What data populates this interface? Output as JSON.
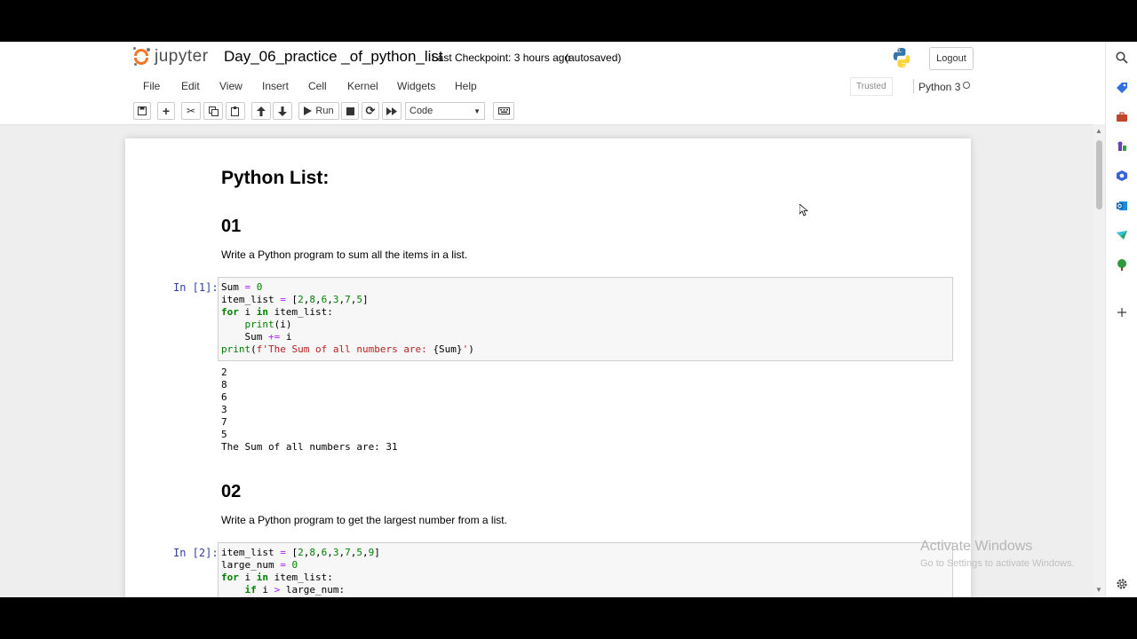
{
  "header": {
    "logo_text": "jupyter",
    "notebook_title": "Day_06_practice _of_python_list",
    "checkpoint": "Last Checkpoint: 3 hours ago",
    "autosave": "(autosaved)",
    "logout": "Logout"
  },
  "menubar": {
    "items": [
      "File",
      "Edit",
      "View",
      "Insert",
      "Cell",
      "Kernel",
      "Widgets",
      "Help"
    ],
    "trusted": "Trusted",
    "kernel_name": "Python 3"
  },
  "toolbar": {
    "run_label": "Run",
    "cell_type": "Code"
  },
  "notebook": {
    "heading": "Python List:",
    "sections": [
      {
        "title": "01",
        "description": "Write a Python program to sum all the items in a list.",
        "prompt": "In [1]:",
        "output": [
          "2",
          "8",
          "6",
          "3",
          "7",
          "5",
          "The Sum of all numbers are: 31"
        ]
      },
      {
        "title": "02",
        "description": "Write a Python program to get the largest number from a list.",
        "prompt": "In [2]:"
      }
    ]
  },
  "watermark": {
    "title": "Activate Windows",
    "subtitle": "Go to Settings to activate Windows."
  },
  "side_panel_icons": [
    "search-icon",
    "tag-icon",
    "briefcase-icon",
    "chess-icon",
    "office-icon",
    "outlook-icon",
    "send-icon",
    "tree-icon",
    "plus-icon",
    "settings-icon"
  ]
}
